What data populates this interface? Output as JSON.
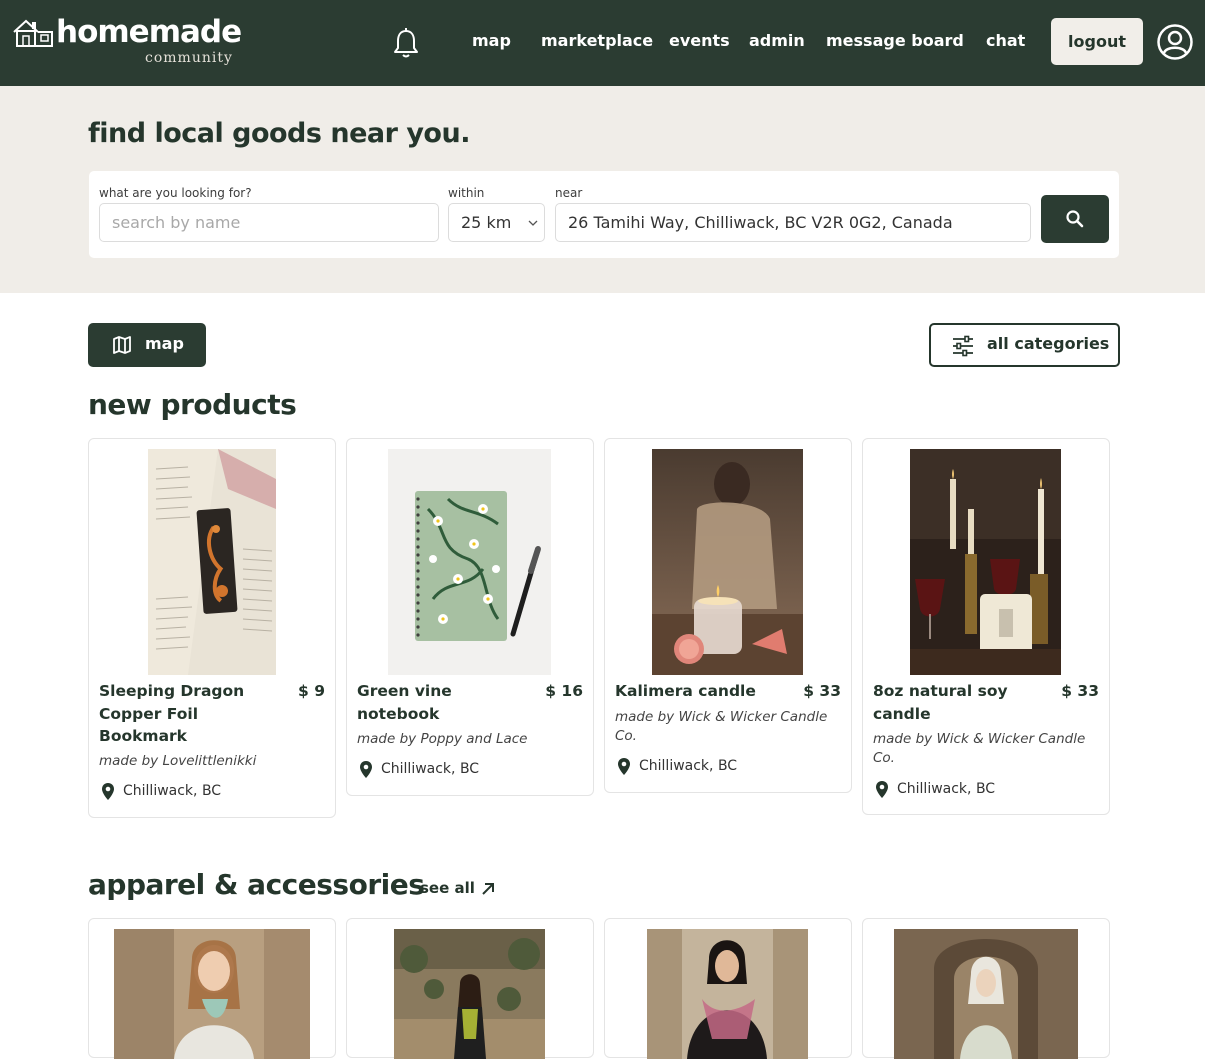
{
  "nav": {
    "logo_title": "homemade",
    "logo_subtitle": "community",
    "links": [
      "map",
      "marketplace",
      "events",
      "admin",
      "message board",
      "chat"
    ],
    "logout_label": "logout"
  },
  "search": {
    "heading": "find local goods near you.",
    "query_label": "what are you looking for?",
    "query_placeholder": "search by name",
    "within_label": "within",
    "within_value": "25 km",
    "near_label": "near",
    "near_value": "26 Tamihi Way, Chilliwack, BC V2R 0G2, Canada"
  },
  "controls": {
    "map_label": "map",
    "categories_label": "all categories"
  },
  "new_products": {
    "title": "new products",
    "items": [
      {
        "name": "Sleeping Dragon Copper Foil Bookmark",
        "price": "$ 9",
        "maker": "made by Lovelittlenikki",
        "location": "Chilliwack, BC"
      },
      {
        "name": "Green vine notebook",
        "price": "$ 16",
        "maker": "made by Poppy and Lace",
        "location": "Chilliwack, BC"
      },
      {
        "name": "Kalimera candle",
        "price": "$ 33",
        "maker": "made by Wick & Wicker Candle Co.",
        "location": "Chilliwack, BC"
      },
      {
        "name": "8oz natural soy candle",
        "price": "$ 33",
        "maker": "made by Wick & Wicker Candle Co.",
        "location": "Chilliwack, BC"
      }
    ]
  },
  "apparel": {
    "title": "apparel & accessories",
    "see_all_label": "see all"
  },
  "colors": {
    "brand_dark": "#2b3c32",
    "band_bg": "#f0ede8",
    "text_dark": "#25362c"
  }
}
